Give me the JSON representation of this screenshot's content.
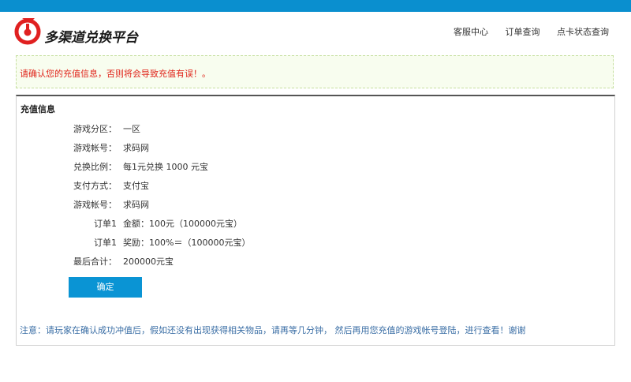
{
  "header": {
    "logo_text": "多渠道兑换平台",
    "nav": [
      "客服中心",
      "订单查询",
      "点卡状态查询"
    ]
  },
  "notice": {
    "text": "请确认您的充值信息，否则将会导致充值有误！。"
  },
  "panel": {
    "title": "充值信息",
    "rows": [
      {
        "label": "游戏分区：",
        "value": "一区"
      },
      {
        "label": "游戏帐号：",
        "value": "求码网"
      },
      {
        "label": "兑换比例：",
        "value": "每1元兑换 1000 元宝"
      },
      {
        "label": "支付方式：",
        "value": "支付宝"
      },
      {
        "label": "游戏帐号：",
        "value": "求码网"
      },
      {
        "label": "订单1",
        "value": "金额：100元（100000元宝）"
      },
      {
        "label": "订单1",
        "value": "奖励：100%＝（100000元宝）"
      },
      {
        "label": "最后合计：",
        "value": "200000元宝"
      }
    ],
    "confirm_label": "确定",
    "footnote": "注意：请玩家在确认成功冲值后，假如还没有出现获得相关物品，请再等几分钟， 然后再用您充值的游戏帐号登陆，进行查看！谢谢"
  },
  "colors": {
    "brand_blue": "#0a8fcf",
    "button_blue": "#0a94d4",
    "warning_red": "#e0251b",
    "logo_red": "#e02020",
    "note_blue": "#3a6ea5"
  }
}
